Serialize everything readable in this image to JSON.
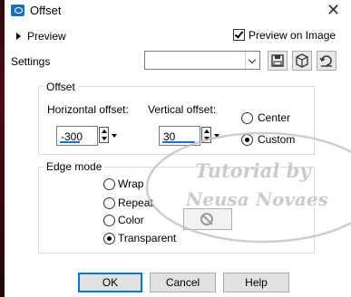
{
  "window": {
    "title": "Offset",
    "close_glyph": "✕"
  },
  "preview": {
    "toggle_label": "Preview",
    "preview_on_image_label": "Preview on Image",
    "preview_on_image_checked": true
  },
  "settings": {
    "label": "Settings",
    "combo_value": "",
    "icons": [
      "save-preset-icon",
      "manage-presets-icon",
      "reset-icon"
    ]
  },
  "offset": {
    "group_label": "Offset",
    "horizontal_label": "Horizontal offset:",
    "horizontal_value": "-300",
    "vertical_label": "Vertical offset:",
    "vertical_value": "30",
    "center_label": "Center",
    "custom_label": "Custom",
    "selected": "Custom"
  },
  "edge_mode": {
    "group_label": "Edge mode",
    "options": [
      "Wrap",
      "Repeat",
      "Color",
      "Transparent"
    ],
    "selected": "Transparent"
  },
  "watermark": {
    "line1": "Tutorial by",
    "line2": "Neusa Novaes"
  },
  "buttons": {
    "ok": "OK",
    "cancel": "Cancel",
    "help": "Help"
  },
  "colors": {
    "accent": "#0078d7",
    "spin_underline": "#1f6fd1"
  }
}
